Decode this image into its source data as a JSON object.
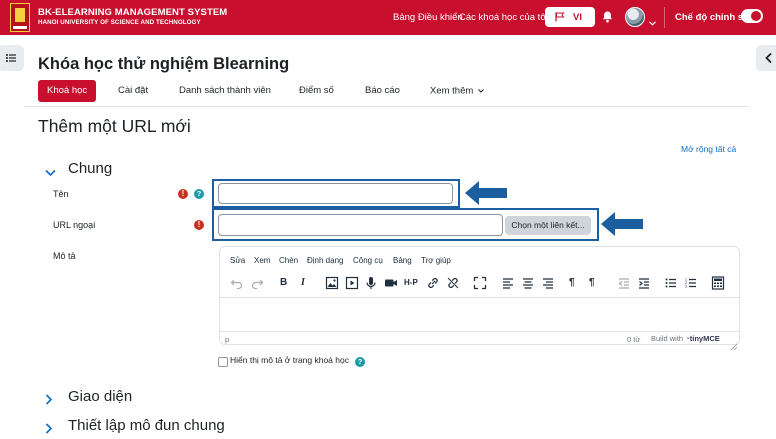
{
  "navbar": {
    "brand_title": "BK-ELEARNING MANAGEMENT SYSTEM",
    "brand_subtitle": "HANOI UNIVERSITY OF SCIENCE AND TECHNOLOGY",
    "links": [
      "Bảng Điều khiển",
      "Các khoá học của tôi"
    ],
    "language": "VI",
    "edit_mode_label": "Chế độ chỉnh sửa",
    "edit_mode_on": true,
    "brand_color": "#c8102e"
  },
  "course": {
    "title": "Khóa học thử nghiệm Blearning"
  },
  "tabs": [
    {
      "label": "Khoá học",
      "active": true
    },
    {
      "label": "Cài đặt",
      "active": false
    },
    {
      "label": "Danh sách thành viên",
      "active": false
    },
    {
      "label": "Điểm số",
      "active": false
    },
    {
      "label": "Báo cáo",
      "active": false
    },
    {
      "label": "Xem thêm",
      "active": false
    }
  ],
  "page": {
    "heading": "Thêm một URL mới",
    "expand_all": "Mở rộng tất cả"
  },
  "sections": {
    "general": "Chung",
    "appearance": "Giao diện",
    "module_settings": "Thiết lập mô đun chung"
  },
  "form": {
    "name_label": "Tên",
    "name_value": "",
    "url_label": "URL ngoại",
    "url_value": "",
    "pick_link_button": "Chọn một liên kết...",
    "description_label": "Mô tả",
    "show_description_label": "Hiển thị mô tả ở trang khoá học",
    "show_description_checked": false
  },
  "editor": {
    "menu": [
      "Sửa",
      "Xem",
      "Chèn",
      "Định dạng",
      "Công cụ",
      "Bảng",
      "Trợ giúp"
    ],
    "status_path": "p",
    "word_count": "0 từ",
    "build_with": "Build with",
    "tinymce": "tinyMCE"
  },
  "highlight_color": "#1c5fa0"
}
